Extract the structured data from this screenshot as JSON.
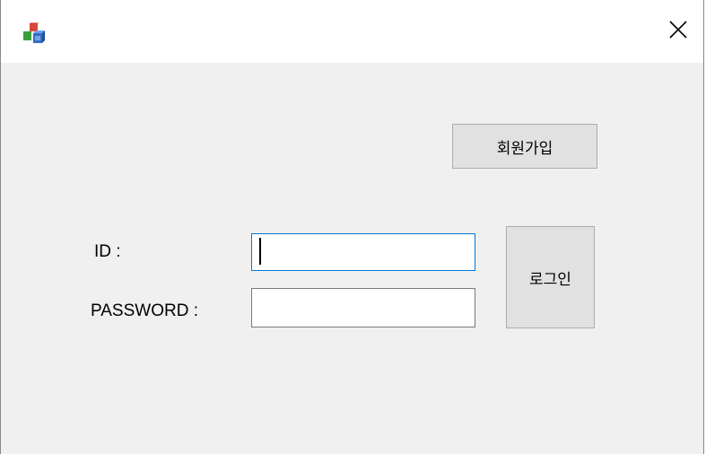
{
  "window": {
    "title": ""
  },
  "titlebar": {
    "app_icon": "app-cubes-icon",
    "close_icon": "close-icon",
    "close_glyph": "✕"
  },
  "form": {
    "signup_label": "회원가입",
    "login_label": "로그인",
    "id_label": "ID :",
    "password_label": "PASSWORD :",
    "id_value": "",
    "password_value": ""
  },
  "colors": {
    "background": "#f0f0f0",
    "titlebar": "#ffffff",
    "button_face": "#e1e1e1",
    "focus_border": "#0078d7"
  }
}
